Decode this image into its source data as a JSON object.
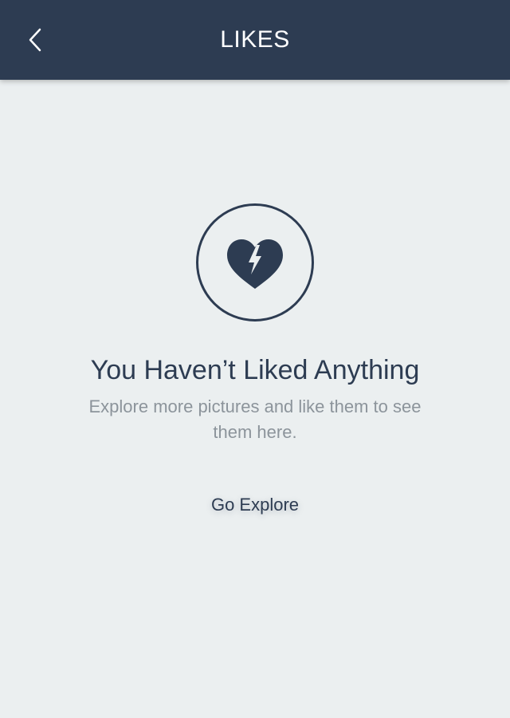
{
  "header": {
    "title": "LIKES",
    "back_icon": "chevron-left-icon",
    "background_color": "#2D3C52"
  },
  "empty_state": {
    "icon": "broken-heart-icon",
    "title": "You Haven’t Liked Anything",
    "subtitle": "Explore more pictures and like them to see them here.",
    "action_label": "Go Explore"
  },
  "colors": {
    "background": "#EBEFF0",
    "primary": "#2D3C52",
    "secondary_text": "#8C949B"
  }
}
